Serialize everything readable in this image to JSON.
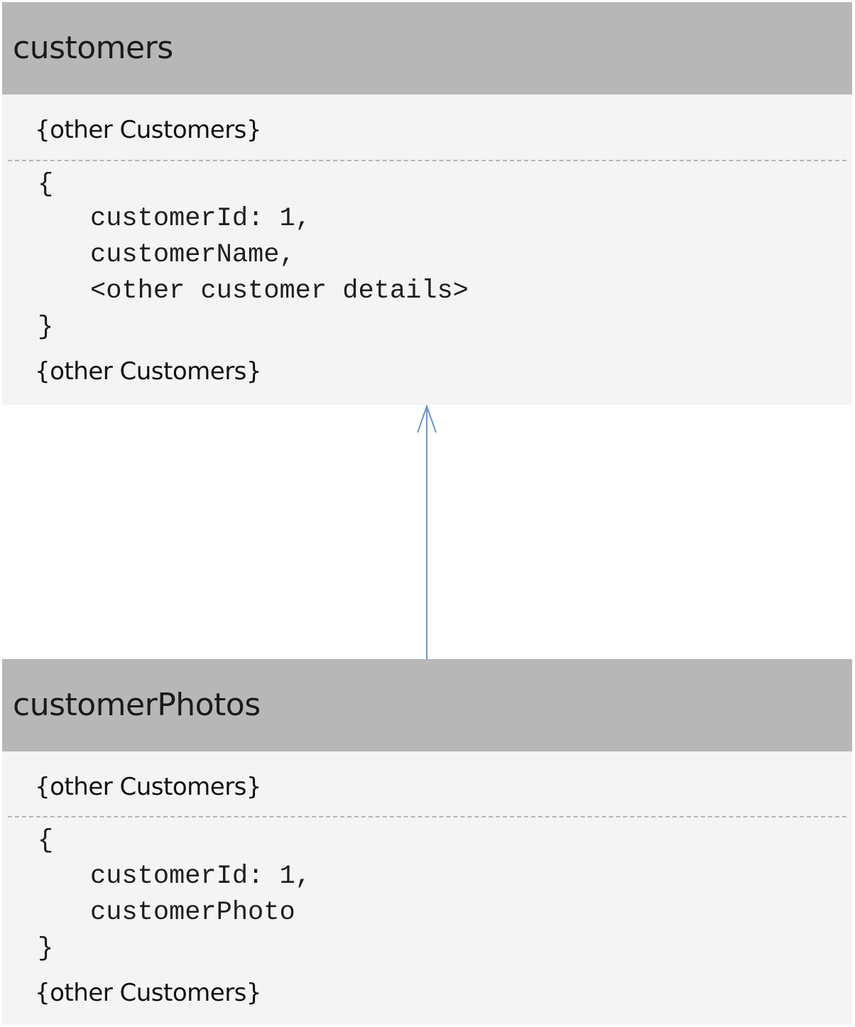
{
  "customers": {
    "title": "customers",
    "other_top": "{other Customers}",
    "open_brace": "{",
    "fields": [
      "customerId: 1,",
      "customerName,",
      "<other customer details>"
    ],
    "close_brace": "}",
    "other_bottom": "{other Customers}"
  },
  "customerPhotos": {
    "title": "customerPhotos",
    "other_top": "{other Customers}",
    "open_brace": "{",
    "fields": [
      "customerId: 1,",
      "customerPhoto"
    ],
    "close_brace": "}",
    "other_bottom": "{other Customers}"
  },
  "colors": {
    "header_bg": "#b7b7b7",
    "body_bg": "#f4f4f4",
    "arrow": "#6f95c4"
  }
}
